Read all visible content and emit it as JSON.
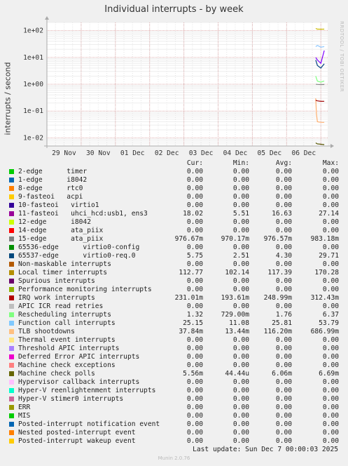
{
  "title": "Individual interrupts - by week",
  "ylabel": "interrupts / second",
  "watermark": "RRDTOOL / TOBI OETIKER",
  "columns": [
    "Cur:",
    "Min:",
    "Avg:",
    "Max:"
  ],
  "last_update": "Last update: Sun Dec  7 00:00:03 2025",
  "footer": "Munin 2.0.76",
  "chart_data": {
    "type": "line",
    "title": "Individual interrupts - by week",
    "ylabel": "interrupts / second",
    "yscale": "log",
    "ylim": [
      0.005,
      200
    ],
    "yticks": [
      0.01,
      0.1,
      1,
      10,
      100
    ],
    "ytick_labels": [
      "1e-02",
      "1e-01",
      "1e+00",
      "1e+01",
      "1e+02"
    ],
    "xtick_labels": [
      "29 Nov",
      "30 Nov",
      "01 Dec",
      "02 Dec",
      "03 Dec",
      "04 Dec",
      "05 Dec",
      "06 Dec"
    ],
    "xlim_days": [
      0,
      8.2
    ],
    "grid": true,
    "series": [
      {
        "name": "Local timer interrupts",
        "color": "#ccbb00",
        "x": [
          7.85,
          7.9,
          8.0,
          8.1
        ],
        "y": [
          120,
          113,
          112,
          112.77
        ]
      },
      {
        "name": "Function call interrupts",
        "color": "#8fc8ff",
        "x": [
          7.85,
          7.9,
          8.0,
          8.1
        ],
        "y": [
          25,
          28,
          24,
          25.15
        ]
      },
      {
        "name": "11-fasteoi",
        "color": "#8000ff",
        "x": [
          7.85,
          7.9,
          8.0,
          8.1
        ],
        "y": [
          10,
          8,
          6,
          18.02
        ]
      },
      {
        "name": "65537-edge",
        "color": "#004080",
        "x": [
          7.85,
          7.9,
          8.0,
          8.1
        ],
        "y": [
          8,
          5,
          4,
          5.75
        ]
      },
      {
        "name": "Rescheduling interrupts",
        "color": "#80ff80",
        "x": [
          7.85,
          7.9,
          8.0,
          8.1
        ],
        "y": [
          2.0,
          1.3,
          1.2,
          1.32
        ]
      },
      {
        "name": "15-edge",
        "color": "#888888",
        "x": [
          7.85,
          7.9,
          8.0,
          8.1
        ],
        "y": [
          1.0,
          0.98,
          0.97,
          0.977
        ]
      },
      {
        "name": "TLB shootdowns",
        "color": "#ffb070",
        "x": [
          7.85,
          7.87,
          7.9,
          8.0,
          8.1
        ],
        "y": [
          0.3,
          0.08,
          0.04,
          0.038,
          0.038
        ]
      },
      {
        "name": "IRQ work interrupts",
        "color": "#a00000",
        "x": [
          7.85,
          7.9,
          8.0,
          8.1
        ],
        "y": [
          0.25,
          0.24,
          0.23,
          0.231
        ]
      },
      {
        "name": "Machine check polls",
        "color": "#555500",
        "x": [
          7.85,
          7.9,
          8.0,
          8.1
        ],
        "y": [
          0.0065,
          0.006,
          0.0058,
          0.0056
        ]
      }
    ]
  },
  "legend": [
    {
      "name": "2-edge      timer",
      "color": "#00cc00",
      "cur": "0.00",
      "min": "0.00",
      "avg": "0.00",
      "max": "0.00"
    },
    {
      "name": "1-edge      i8042",
      "color": "#0066b3",
      "cur": "0.00",
      "min": "0.00",
      "avg": "0.00",
      "max": "0.00"
    },
    {
      "name": "8-edge      rtc0",
      "color": "#ff8000",
      "cur": "0.00",
      "min": "0.00",
      "avg": "0.00",
      "max": "0.00"
    },
    {
      "name": "9-fasteoi   acpi",
      "color": "#ffcc00",
      "cur": "0.00",
      "min": "0.00",
      "avg": "0.00",
      "max": "0.00"
    },
    {
      "name": "10-fasteoi   virtio1",
      "color": "#330099",
      "cur": "0.00",
      "min": "0.00",
      "avg": "0.00",
      "max": "0.00"
    },
    {
      "name": "11-fasteoi   uhci_hcd:usb1, ens3",
      "color": "#990099",
      "cur": "18.02",
      "min": "5.51",
      "avg": "16.63",
      "max": "27.14"
    },
    {
      "name": "12-edge      i8042",
      "color": "#ccff00",
      "cur": "0.00",
      "min": "0.00",
      "avg": "0.00",
      "max": "0.00"
    },
    {
      "name": "14-edge      ata_piix",
      "color": "#ff0000",
      "cur": "0.00",
      "min": "0.00",
      "avg": "0.00",
      "max": "0.00"
    },
    {
      "name": "15-edge      ata_piix",
      "color": "#808080",
      "cur": "976.67m",
      "min": "970.17m",
      "avg": "976.57m",
      "max": "983.18m"
    },
    {
      "name": "65536-edge      virtio0-config",
      "color": "#008f00",
      "cur": "0.00",
      "min": "0.00",
      "avg": "0.00",
      "max": "0.00"
    },
    {
      "name": "65537-edge      virtio0-req.0",
      "color": "#00487d",
      "cur": "5.75",
      "min": "2.51",
      "avg": "4.30",
      "max": "29.71"
    },
    {
      "name": "Non-maskable interrupts",
      "color": "#b35a00",
      "cur": "0.00",
      "min": "0.00",
      "avg": "0.00",
      "max": "0.00"
    },
    {
      "name": "Local timer interrupts",
      "color": "#b38f00",
      "cur": "112.77",
      "min": "102.14",
      "avg": "117.39",
      "max": "170.28"
    },
    {
      "name": "Spurious interrupts",
      "color": "#6b006b",
      "cur": "0.00",
      "min": "0.00",
      "avg": "0.00",
      "max": "0.00"
    },
    {
      "name": "Performance monitoring interrupts",
      "color": "#8fb300",
      "cur": "0.00",
      "min": "0.00",
      "avg": "0.00",
      "max": "0.00"
    },
    {
      "name": "IRQ work interrupts",
      "color": "#b30000",
      "cur": "231.01m",
      "min": "193.61m",
      "avg": "248.99m",
      "max": "312.43m"
    },
    {
      "name": "APIC ICR read retries",
      "color": "#bebebe",
      "cur": "0.00",
      "min": "0.00",
      "avg": "0.00",
      "max": "0.00"
    },
    {
      "name": "Rescheduling interrupts",
      "color": "#80ff80",
      "cur": "1.32",
      "min": "729.00m",
      "avg": "1.76",
      "max": "6.37"
    },
    {
      "name": "Function call interrupts",
      "color": "#80c9ff",
      "cur": "25.15",
      "min": "11.08",
      "avg": "25.81",
      "max": "53.79"
    },
    {
      "name": "TLB shootdowns",
      "color": "#ffc080",
      "cur": "37.84m",
      "min": "13.44m",
      "avg": "116.20m",
      "max": "686.99m"
    },
    {
      "name": "Thermal event interrupts",
      "color": "#ffe680",
      "cur": "0.00",
      "min": "0.00",
      "avg": "0.00",
      "max": "0.00"
    },
    {
      "name": "Threshold APIC interrupts",
      "color": "#aa80ff",
      "cur": "0.00",
      "min": "0.00",
      "avg": "0.00",
      "max": "0.00"
    },
    {
      "name": "Deferred Error APIC interrupts",
      "color": "#ee00cc",
      "cur": "0.00",
      "min": "0.00",
      "avg": "0.00",
      "max": "0.00"
    },
    {
      "name": "Machine check exceptions",
      "color": "#ff8080",
      "cur": "0.00",
      "min": "0.00",
      "avg": "0.00",
      "max": "0.00"
    },
    {
      "name": "Machine check polls",
      "color": "#666600",
      "cur": "5.56m",
      "min": "44.44u",
      "avg": "6.06m",
      "max": "6.69m"
    },
    {
      "name": "Hypervisor callback interrupts",
      "color": "#ffbfff",
      "cur": "0.00",
      "min": "0.00",
      "avg": "0.00",
      "max": "0.00"
    },
    {
      "name": "Hyper-V reenlightenment interrupts",
      "color": "#00ffcc",
      "cur": "0.00",
      "min": "0.00",
      "avg": "0.00",
      "max": "0.00"
    },
    {
      "name": "Hyper-V stimer0 interrupts",
      "color": "#cc6699",
      "cur": "0.00",
      "min": "0.00",
      "avg": "0.00",
      "max": "0.00"
    },
    {
      "name": "ERR",
      "color": "#999900",
      "cur": "0.00",
      "min": "0.00",
      "avg": "0.00",
      "max": "0.00"
    },
    {
      "name": "MIS",
      "color": "#00cc00",
      "cur": "0.00",
      "min": "0.00",
      "avg": "0.00",
      "max": "0.00"
    },
    {
      "name": "Posted-interrupt notification event",
      "color": "#0066b3",
      "cur": "0.00",
      "min": "0.00",
      "avg": "0.00",
      "max": "0.00"
    },
    {
      "name": "Nested posted-interrupt event",
      "color": "#ff8000",
      "cur": "0.00",
      "min": "0.00",
      "avg": "0.00",
      "max": "0.00"
    },
    {
      "name": "Posted-interrupt wakeup event",
      "color": "#ffcc00",
      "cur": "0.00",
      "min": "0.00",
      "avg": "0.00",
      "max": "0.00"
    }
  ]
}
